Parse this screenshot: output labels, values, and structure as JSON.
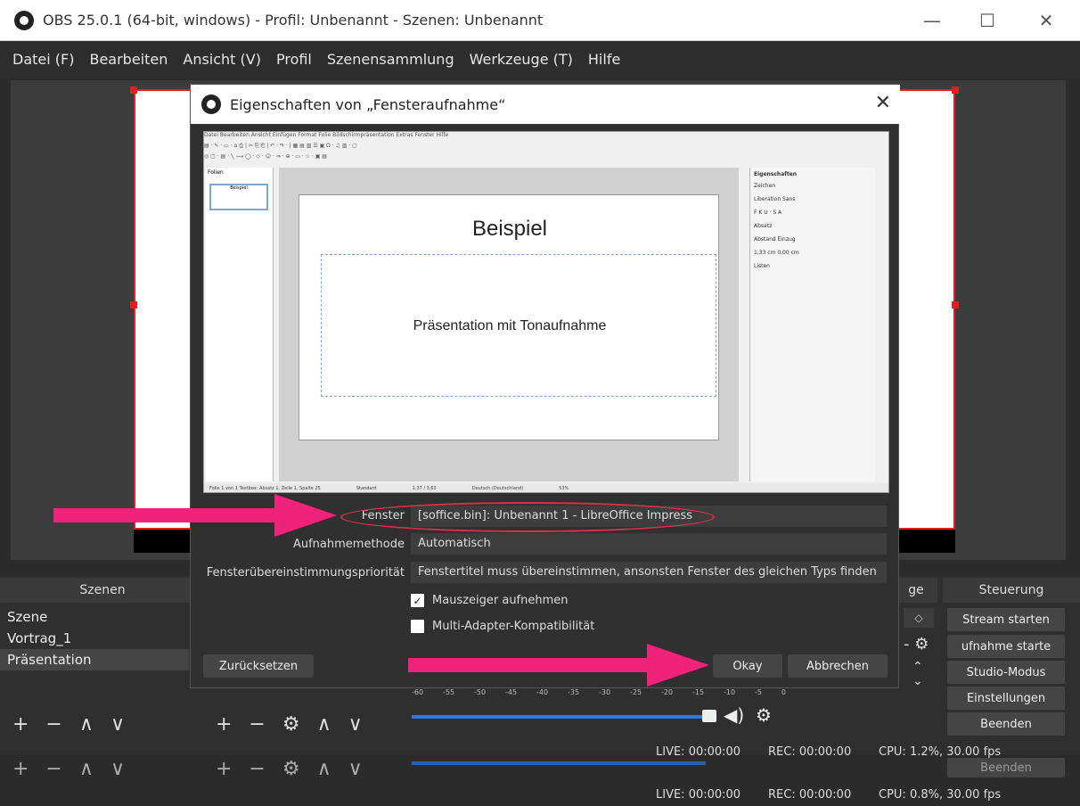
{
  "window": {
    "title": "OBS 25.0.1 (64-bit, windows) - Profil: Unbenannt - Szenen: Unbenannt",
    "minimize": "—",
    "maximize": "☐",
    "close": "✕"
  },
  "menu": [
    "Datei (F)",
    "Bearbeiten",
    "Ansicht (V)",
    "Profil",
    "Szenensammlung",
    "Werkzeuge (T)",
    "Hilfe"
  ],
  "docks": {
    "scenes_title": "Szenen",
    "scenes": [
      "Szene",
      "Vortrag_1",
      "Präsentation"
    ],
    "mixer_title_partial": "ge",
    "controls_title": "Steuerung",
    "controls": [
      "Stream starten",
      "ufnahme starte",
      "Studio-Modus",
      "Einstellungen",
      "Beenden"
    ],
    "controls_ghost": "Beenden",
    "scene_tools": "+ − ∧ ∨",
    "source_tools": "+ − ⚙ ∧ ∨",
    "meter_ticks": [
      "-60",
      "-55",
      "-50",
      "-45",
      "-40",
      "-35",
      "-30",
      "-25",
      "-20",
      "-15",
      "-10",
      "-5",
      "0"
    ]
  },
  "status": {
    "live": "LIVE: 00:00:00",
    "rec": "REC: 00:00:00",
    "cpu": "CPU: 1.2%, 30.00 fps",
    "live2": "LIVE: 00:00:00",
    "rec2": "REC: 00:00:00",
    "cpu2": "CPU: 0.8%, 30.00 fps"
  },
  "dialog": {
    "title": "Eigenschaften von „Fensteraufnahme“",
    "close": "✕",
    "preview": {
      "menu": "Datei  Bearbeiten  Ansicht  Einfügen  Format  Folie  Bildschirmpräsentation  Extras  Fenster  Hilfe",
      "toolbar1": "▤ · ✎ · ▭ · ⌂ ⎙ | ✂ ⎘ ⎗ | ↶ · ↷ · | ▦ ▤ ▥ ☰ ▣ Ω · ♫ ▥ · ▢",
      "toolbar2": "◎ ▢ · ▤ · ╲ ⟶ ◯ · ◇ · ☺ · ⇒ · ⊕ · ▭ · ☆ · ▣ ▤",
      "sidebar_title": "Folien",
      "thumb_text": "Beispiel",
      "slide_title": "Beispiel",
      "slide_sub": "Präsentation mit Tonaufnahme",
      "props_title": "Eigenschaften",
      "props_lines": [
        "Zeichen",
        "Liberation Sans",
        "F K U · S A",
        "Absatz",
        "Abstand   Einzug",
        "1,33 cm   0,00 cm",
        "Listen"
      ],
      "statusbar": [
        "Folie 1 von 1  Textbox: Absatz 1, Zeile 1, Spalte 25",
        "Standard",
        "1,37 / 3,63",
        "Deutsch (Deutschland)",
        "53%"
      ]
    },
    "fields": [
      {
        "label": "Fenster",
        "value": "[soffice.bin]: Unbenannt 1 - LibreOffice Impress"
      },
      {
        "label": "Aufnahmemethode",
        "value": "Automatisch"
      },
      {
        "label": "Fensterübereinstimmungspriorität",
        "value": "Fenstertitel muss übereinstimmen, ansonsten Fenster des gleichen Typs finden"
      }
    ],
    "checks": [
      {
        "label": "Mauszeiger aufnehmen",
        "checked": "✓"
      },
      {
        "label": "Multi-Adapter-Kompatibilität",
        "checked": ""
      }
    ],
    "reset": "Zurücksetzen",
    "ok": "Okay",
    "cancel": "Abbrechen"
  },
  "colors": {
    "arrow": "#f0237a",
    "selection": "#e0201e",
    "slider": "#2c7be5"
  }
}
